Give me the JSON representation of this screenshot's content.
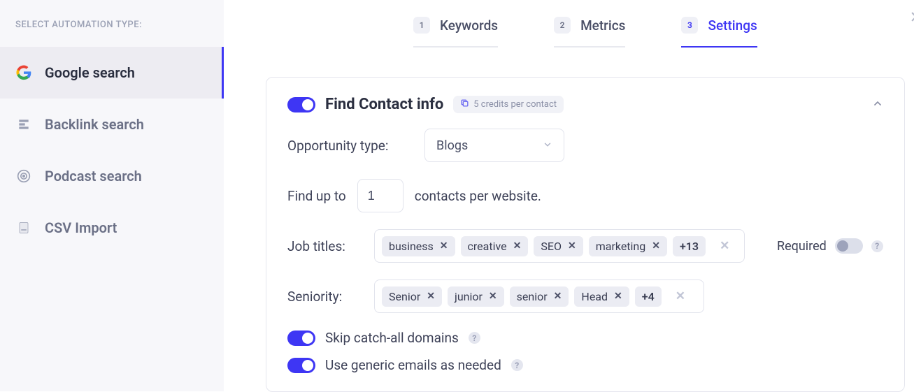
{
  "sidebar": {
    "heading": "SELECT AUTOMATION TYPE:",
    "items": [
      {
        "label": "Google search",
        "icon": "google-icon",
        "active": true
      },
      {
        "label": "Backlink search",
        "icon": "backlink-icon",
        "active": false
      },
      {
        "label": "Podcast search",
        "icon": "podcast-icon",
        "active": false
      },
      {
        "label": "CSV Import",
        "icon": "csv-icon",
        "active": false
      }
    ]
  },
  "tabs": [
    {
      "num": "1",
      "label": "Keywords",
      "active": false
    },
    {
      "num": "2",
      "label": "Metrics",
      "active": false
    },
    {
      "num": "3",
      "label": "Settings",
      "active": true
    }
  ],
  "panel": {
    "title": "Find Contact info",
    "credits_badge": "5 credits per contact",
    "toggle_main": true,
    "opportunity": {
      "label": "Opportunity type:",
      "value": "Blogs"
    },
    "findup": {
      "pre": "Find up to",
      "value": "1",
      "post": "contacts per website."
    },
    "job_titles": {
      "label": "Job titles:",
      "chips": [
        "business",
        "creative",
        "SEO",
        "marketing"
      ],
      "more": "+13",
      "required_label": "Required",
      "required_on": false
    },
    "seniority": {
      "label": "Seniority:",
      "chips": [
        "Senior",
        "junior",
        "senior",
        "Head"
      ],
      "more": "+4"
    },
    "skip_catchall": {
      "label": "Skip catch-all domains",
      "on": true
    },
    "generic_emails": {
      "label": "Use generic emails as needed",
      "on": true
    }
  }
}
